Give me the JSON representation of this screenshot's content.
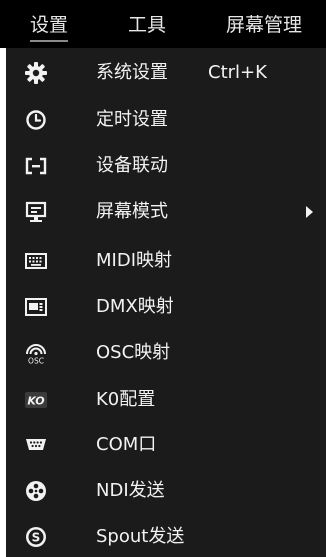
{
  "menubar": {
    "items": [
      {
        "label": "设置"
      },
      {
        "label": "工具"
      },
      {
        "label": "屏幕管理"
      }
    ]
  },
  "settings_menu": {
    "items": [
      {
        "label": "系统设置",
        "shortcut": "Ctrl+K",
        "icon": "gear-icon"
      },
      {
        "label": "定时设置",
        "icon": "clock-icon"
      },
      {
        "label": "设备联动",
        "icon": "device-link-icon"
      },
      {
        "label": "屏幕模式",
        "icon": "monitor-icon",
        "has_submenu": true
      },
      {
        "label": "MIDI映射",
        "icon": "keyboard-icon"
      },
      {
        "label": "DMX映射",
        "icon": "dmx-icon"
      },
      {
        "label": "OSC映射",
        "icon": "osc-icon",
        "icon_text": "OSC"
      },
      {
        "label": "K0配置",
        "icon": "ko-icon",
        "icon_text": "KO"
      },
      {
        "label": "COM口",
        "icon": "serial-port-icon"
      },
      {
        "label": "NDI发送",
        "icon": "ndi-icon"
      },
      {
        "label": "Spout发送",
        "icon": "spout-icon",
        "icon_text": "S"
      }
    ]
  },
  "colors": {
    "menubar_bg": "#000000",
    "menu_bg": "#1b1b1b",
    "text": "#f2f2f2"
  }
}
